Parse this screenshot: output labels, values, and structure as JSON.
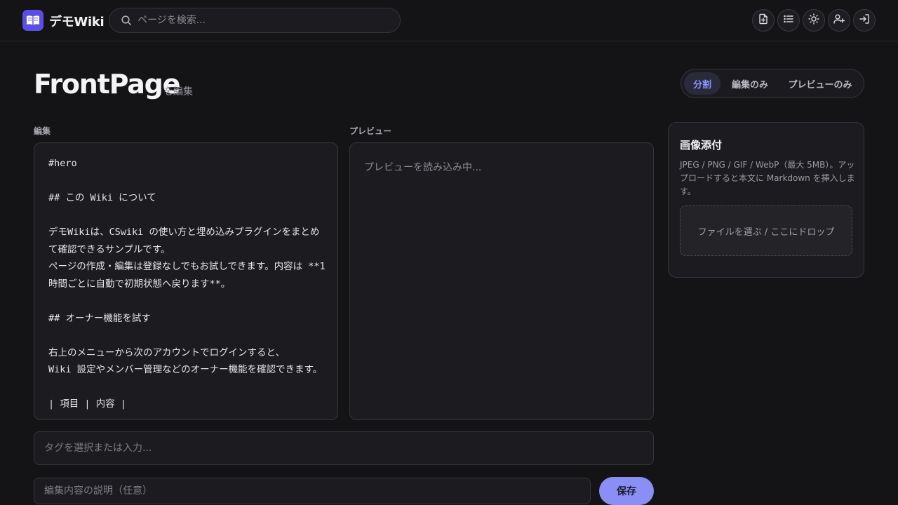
{
  "header": {
    "brand": "デモWiki",
    "search_placeholder": "ページを検索..."
  },
  "page": {
    "title": "FrontPage",
    "title_suffix": "を編集"
  },
  "view_toggle": {
    "options": [
      "分割",
      "編集のみ",
      "プレビューのみ"
    ],
    "active": "分割"
  },
  "editor": {
    "label": "編集",
    "content": "#hero\n\n## この Wiki について\n\nデモWikiは、CSwiki の使い方と埋め込みプラグインをまとめて確認できるサンプルです。\nページの作成・編集は登録なしでもお試しできます。内容は **1時間ごとに自動で初期状態へ戻ります**。\n\n## オーナー機能を試す\n\n右上のメニューから次のアカウントでログインすると、\nWiki 設定やメンバー管理などのオーナー機能を確認できます。\n\n| 項目 | 内容 |"
  },
  "preview": {
    "label": "プレビュー",
    "loading_text": "プレビューを読み込み中..."
  },
  "attach": {
    "title": "画像添付",
    "description": "JPEG / PNG / GIF / WebP（最大 5MB）。アップロードすると本文に Markdown を挿入します。",
    "dropzone_text": "ファイルを選ぶ / ここにドロップ"
  },
  "tags": {
    "placeholder": "タグを選択または入力..."
  },
  "edit_summary": {
    "placeholder": "編集内容の説明（任意）"
  },
  "save_label": "保存",
  "colors": {
    "background": "#141417",
    "accent": "#8b8ff5",
    "logo": "#5b4ee6"
  },
  "icons": {
    "header": [
      "new-page-icon",
      "list-icon",
      "theme-sun-icon",
      "add-user-icon",
      "login-icon"
    ]
  }
}
